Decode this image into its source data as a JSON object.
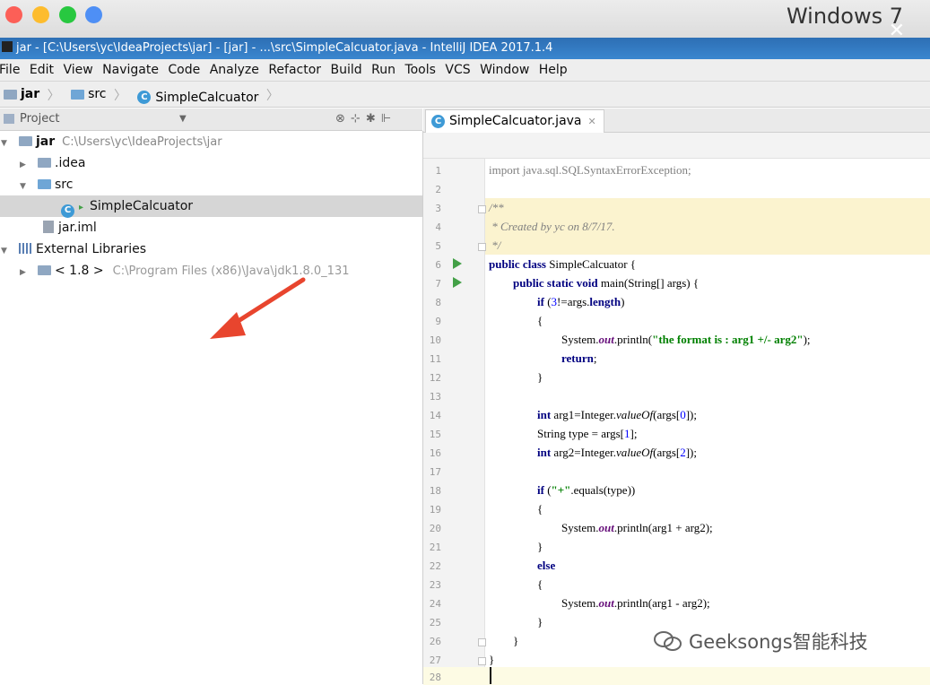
{
  "mac_window": {
    "label": "Windows 7",
    "close": "✕"
  },
  "titlebar": {
    "text": "jar - [C:\\Users\\yc\\IdeaProjects\\jar] - [jar] - ...\\src\\SimpleCalcuator.java - IntelliJ IDEA 2017.1.4"
  },
  "menu": [
    "File",
    "Edit",
    "View",
    "Navigate",
    "Code",
    "Analyze",
    "Refactor",
    "Build",
    "Run",
    "Tools",
    "VCS",
    "Window",
    "Help"
  ],
  "breadcrumbs": [
    "jar",
    "src",
    "SimpleCalcuator"
  ],
  "project_panel": {
    "title": "Project",
    "tree": {
      "root": {
        "name": "jar",
        "path": "C:\\Users\\yc\\IdeaProjects\\jar"
      },
      "idea": ".idea",
      "src": "src",
      "selected_file": "SimpleCalcuator",
      "iml": "jar.iml",
      "ext_libs": "External Libraries",
      "jdk": {
        "name": "< 1.8 >",
        "path": "C:\\Program Files (x86)\\Java\\jdk1.8.0_131"
      }
    }
  },
  "editor": {
    "tab": "SimpleCalcuator.java",
    "line_numbers": [
      "1",
      "2",
      "3",
      "4",
      "5",
      "6",
      "7",
      "8",
      "9",
      "10",
      "11",
      "12",
      "13",
      "14",
      "15",
      "16",
      "17",
      "18",
      "19",
      "20",
      "21",
      "22",
      "23",
      "24",
      "25",
      "26",
      "27",
      "28"
    ],
    "code": {
      "l1_import": "import ",
      "l1_pkg": "java.sql.SQLSyntaxErrorException;",
      "l3": "/**",
      "l4": " * Created by yc on 8/7/17.",
      "l5": " */",
      "l6_kw": "public class ",
      "l6_name": "SimpleCalcuator {",
      "l7_kw": "public static void ",
      "l7_rest": "main(String[] args) {",
      "l8_kw": "if ",
      "l8_a": "(",
      "l8_num": "3",
      "l8_b": "!=args.",
      "l8_field": "length",
      "l8_c": ")",
      "l9": "{",
      "l10_a": "System.",
      "l10_out": "out",
      "l10_b": ".println(",
      "l10_str": "\"the format is : arg1 +/- arg2\"",
      "l10_c": ");",
      "l11_kw": "return",
      "l11_b": ";",
      "l12": "}",
      "l14_kw": "int ",
      "l14_a": "arg1=Integer.",
      "l14_m": "valueOf",
      "l14_b": "(args[",
      "l14_num": "0",
      "l14_c": "]);",
      "l15_a": "String type = args[",
      "l15_num": "1",
      "l15_b": "];",
      "l16_kw": "int ",
      "l16_a": "arg2=Integer.",
      "l16_m": "valueOf",
      "l16_b": "(args[",
      "l16_num": "2",
      "l16_c": "]);",
      "l18_kw": "if ",
      "l18_a": "(",
      "l18_str": "\"+\"",
      "l18_b": ".equals(type))",
      "l19": "{",
      "l20_a": "System.",
      "l20_out": "out",
      "l20_b": ".println(arg1 + arg2);",
      "l21": "}",
      "l22_kw": "else",
      "l23": "{",
      "l24_a": "System.",
      "l24_out": "out",
      "l24_b": ".println(arg1 - arg2);",
      "l25": "}",
      "l26": "}",
      "l27": "}"
    }
  },
  "watermark": "Geeksongs智能科技"
}
